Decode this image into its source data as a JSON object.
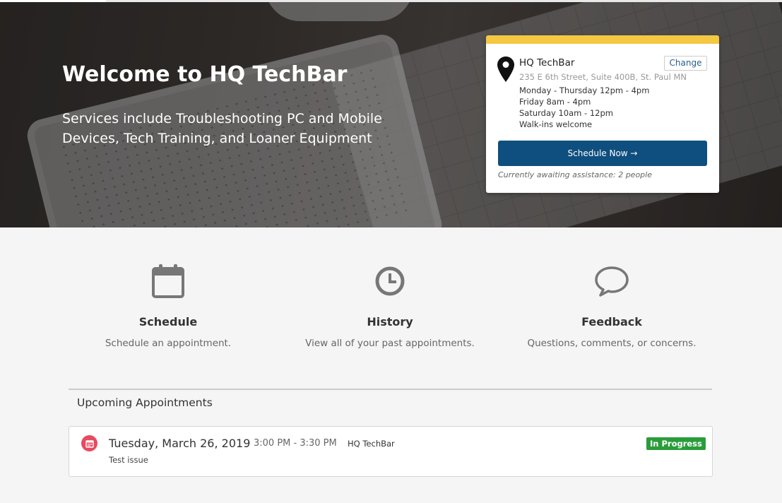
{
  "hero": {
    "title": "Welcome to HQ TechBar",
    "subtitle": "Services include Troubleshooting PC and Mobile Devices, Tech Training, and Loaner Equipment"
  },
  "location_card": {
    "name": "HQ TechBar",
    "change_label": "Change",
    "address": "235 E 6th Street, Suite 400B, St. Paul MN",
    "hours": [
      "Monday - Thursday 12pm - 4pm",
      "Friday 8am - 4pm",
      "Saturday 10am - 12pm",
      "Walk-ins welcome"
    ],
    "schedule_button": "Schedule Now →",
    "waiting_text": "Currently awaiting assistance: 2 people",
    "accent_color": "#f5c842",
    "button_color": "#0f4f7f"
  },
  "features": [
    {
      "icon": "calendar-icon",
      "title": "Schedule",
      "description": "Schedule an appointment."
    },
    {
      "icon": "clock-icon",
      "title": "History",
      "description": "View all of your past appointments."
    },
    {
      "icon": "chat-bubble-icon",
      "title": "Feedback",
      "description": "Questions, comments, or concerns."
    }
  ],
  "upcoming": {
    "heading": "Upcoming Appointments",
    "appointments": [
      {
        "icon": "calendar-icon",
        "date": "Tuesday, March 26, 2019",
        "time": "3:00 PM - 3:30 PM",
        "location": "HQ TechBar",
        "description": "Test issue",
        "status": "In Progress",
        "status_color": "#2a9d3a",
        "icon_color": "#e84a5f"
      }
    ]
  }
}
